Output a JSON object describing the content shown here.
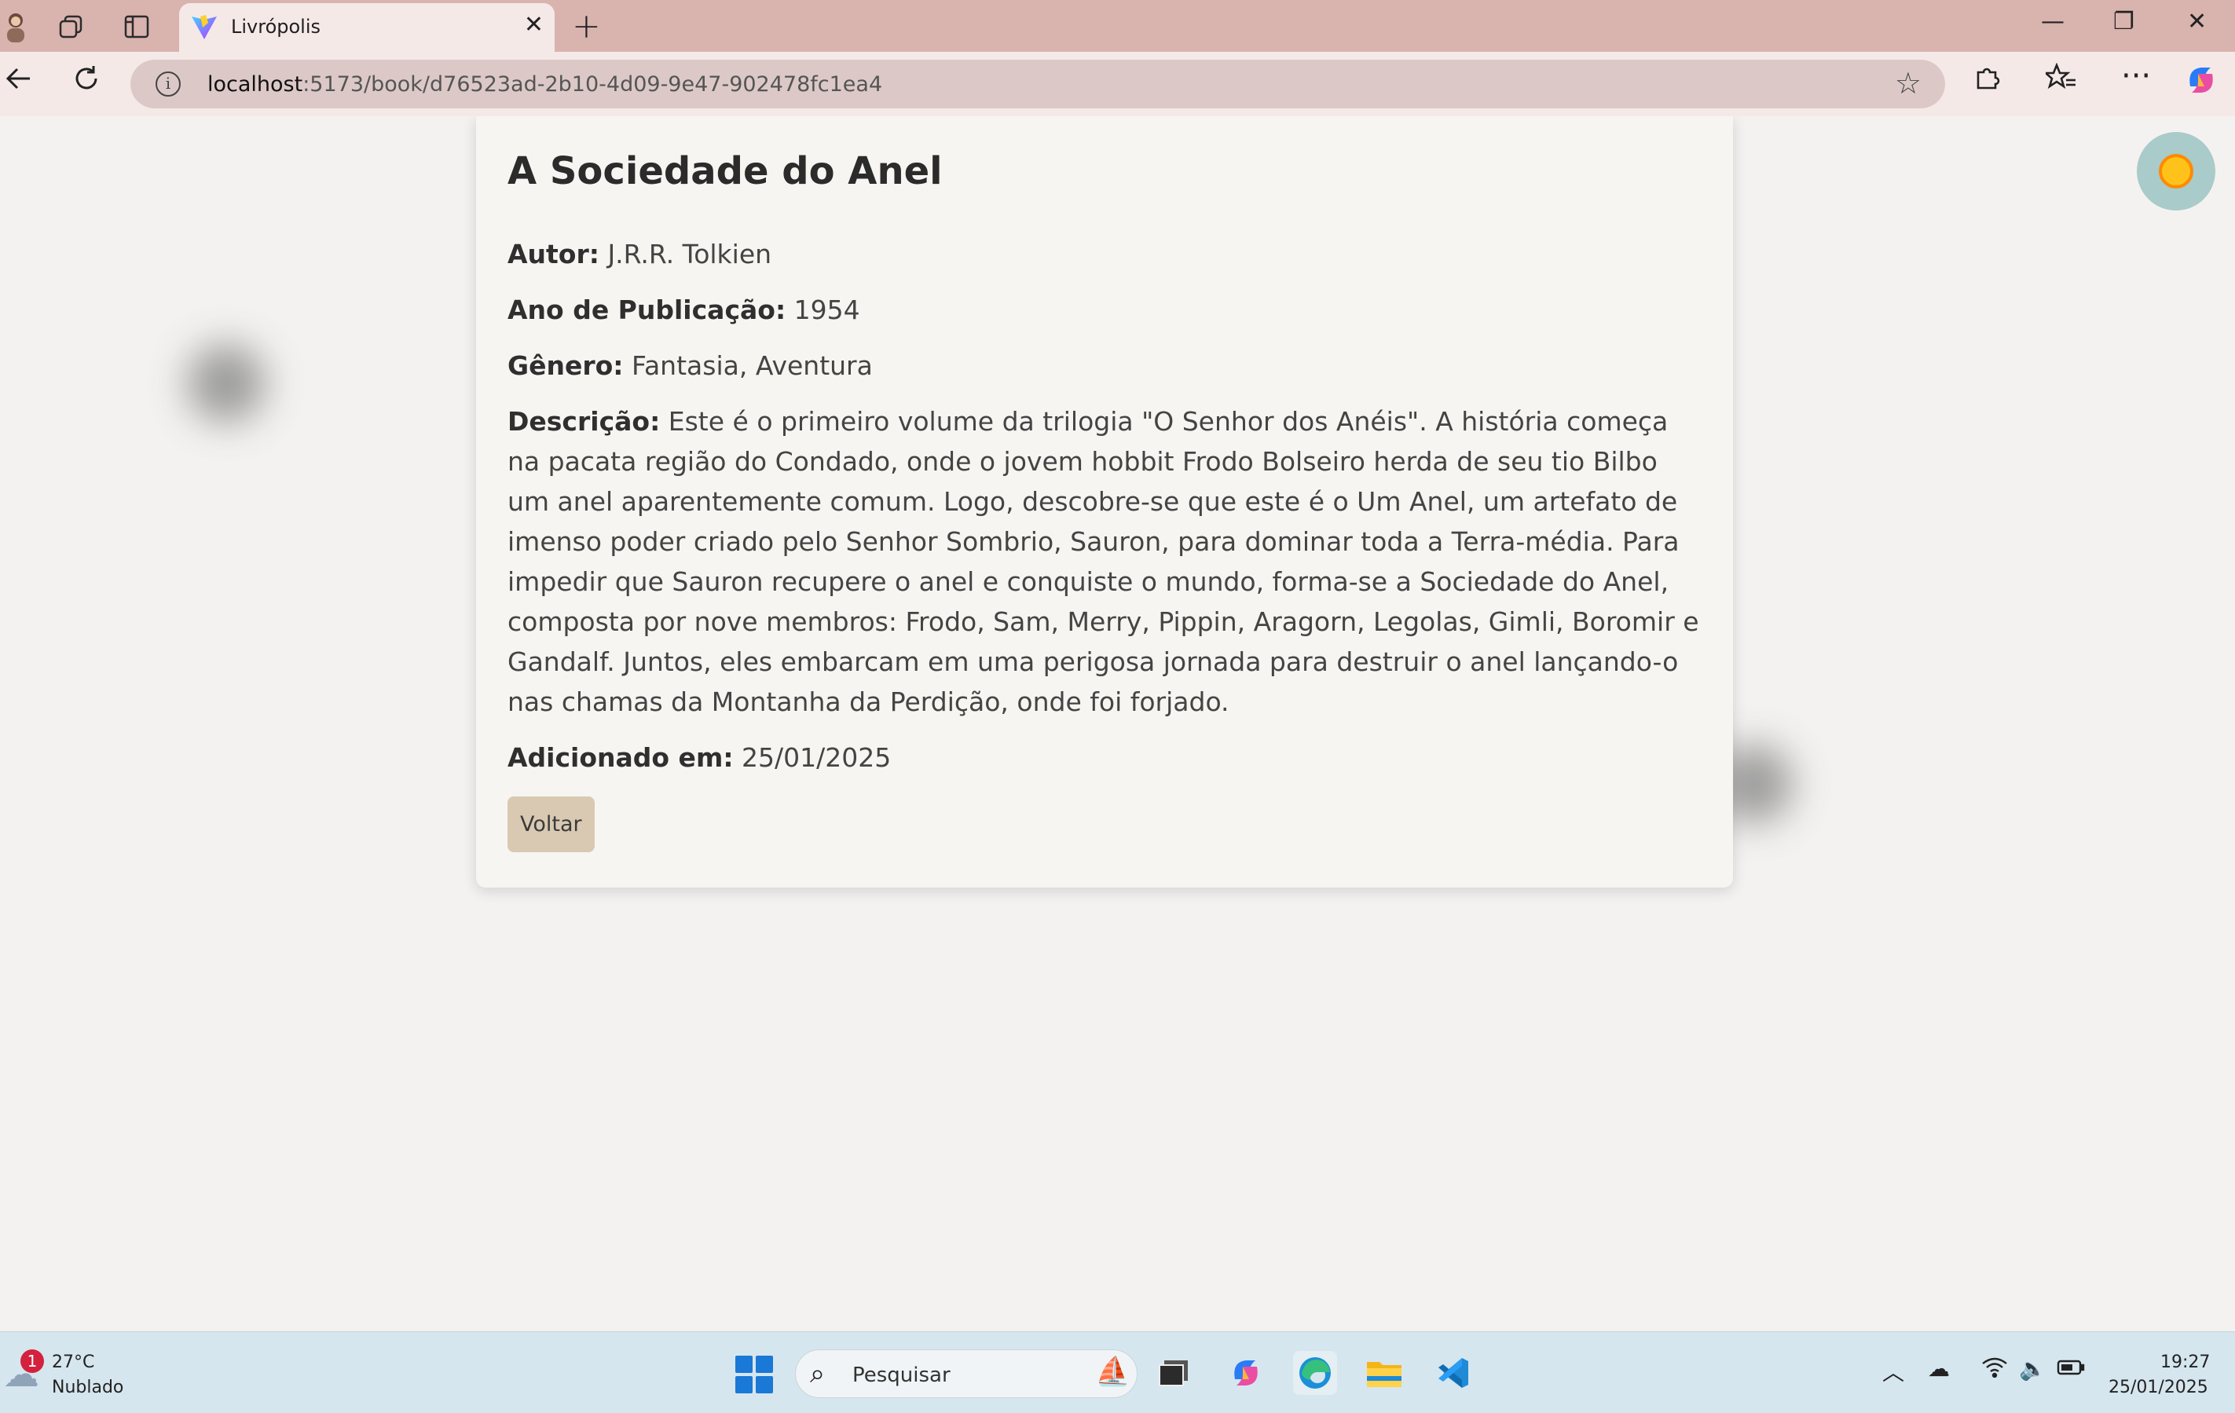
{
  "browser": {
    "tab_title": "Livrópolis",
    "tab_close": "✕",
    "new_tab": "+",
    "url_host": "localhost",
    "url_path": ":5173/book/d76523ad-2b10-4d09-9e47-902478fc1ea4",
    "window_controls": {
      "minimize": "—",
      "restore": "❐",
      "close": "✕"
    }
  },
  "book": {
    "title": "A Sociedade do Anel",
    "author_label": "Autor:",
    "author": "J.R.R. Tolkien",
    "year_label": "Ano de Publicação:",
    "year": "1954",
    "genre_label": "Gênero:",
    "genre": "Fantasia, Aventura",
    "description_label": "Descrição:",
    "description": "Este é o primeiro volume da trilogia \"O Senhor dos Anéis\". A história começa na pacata região do Condado, onde o jovem hobbit Frodo Bolseiro herda de seu tio Bilbo um anel aparentemente comum. Logo, descobre-se que este é o Um Anel, um artefato de imenso poder criado pelo Senhor Sombrio, Sauron, para dominar toda a Terra-média. Para impedir que Sauron recupere o anel e conquiste o mundo, forma-se a Sociedade do Anel, composta por nove membros: Frodo, Sam, Merry, Pippin, Aragorn, Legolas, Gimli, Boromir e Gandalf. Juntos, eles embarcam em uma perigosa jornada para destruir o anel lançando-o nas chamas da Montanha da Perdição, onde foi forjado.",
    "added_label": "Adicionado em:",
    "added_date": "25/01/2025",
    "back_button": "Voltar"
  },
  "taskbar": {
    "weather_badge": "1",
    "weather_temp": "27°C",
    "weather_desc": "Nublado",
    "search_placeholder": "Pesquisar",
    "time": "19:27",
    "date": "25/01/2025"
  },
  "colors": {
    "tabbar": "#d9b3ae",
    "page_bg": "#f4f2f0",
    "button_bg": "#d9c9b2",
    "theme_toggle": "#a9cbc9"
  }
}
